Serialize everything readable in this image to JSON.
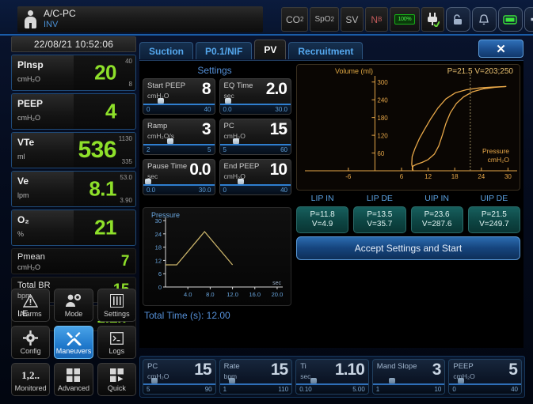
{
  "header": {
    "patient_mode": "A/C-PC",
    "patient_sub": "INV",
    "person_icon": "person-icon",
    "status_icons": [
      {
        "name": "co2-indicator",
        "label": "CO",
        "sub": "2"
      },
      {
        "name": "spo2-indicator",
        "label": "SpO",
        "sub": "2"
      },
      {
        "name": "sv-indicator",
        "label": "SV",
        "sub": ""
      },
      {
        "name": "nb-indicator",
        "label": "N",
        "sub": "B"
      }
    ],
    "battery_label": "100%",
    "plug_icon": "power-plug-icon",
    "lock_icon": "lock-icon",
    "bell_icon": "alarm-bell-icon",
    "screen_icon": "screen-icon",
    "plus_icon": "plus-icon"
  },
  "sidebar": {
    "clock": "22/08/21 10:52:06",
    "measurements": [
      {
        "label": "PInsp",
        "unit": "cmH₂O",
        "value": "20",
        "high": "40",
        "low": "8",
        "big": false
      },
      {
        "label": "PEEP",
        "unit": "cmH₂O",
        "value": "4",
        "high": "",
        "low": "",
        "big": false
      },
      {
        "label": "VTe",
        "unit": "ml",
        "value": "536",
        "high": "1130",
        "low": "335",
        "big": true
      },
      {
        "label": "Ve",
        "unit": "lpm",
        "value": "8.1",
        "high": "53.0",
        "low": "3.90",
        "big": false
      },
      {
        "label": "O₂",
        "unit": "%",
        "value": "21",
        "high": "",
        "low": "",
        "big": false
      }
    ],
    "secondary": [
      {
        "label": "Pmean",
        "unit": "cmH₂O",
        "value": "7"
      },
      {
        "label": "Total BR",
        "unit": "bpm",
        "value": "15"
      },
      {
        "label": "I:E",
        "unit": "",
        "value": "1:2.7"
      }
    ],
    "buttons": [
      {
        "label": "Alarms",
        "icon": "warning-triangle-icon",
        "active": false
      },
      {
        "label": "Mode",
        "icon": "user-gear-icon",
        "active": false
      },
      {
        "label": "Settings",
        "icon": "sliders-icon",
        "active": false
      },
      {
        "label": "Config",
        "icon": "gear-icon",
        "active": false
      },
      {
        "label": "Maneuvers",
        "icon": "tools-icon",
        "active": true
      },
      {
        "label": "Logs",
        "icon": "terminal-icon",
        "active": false
      },
      {
        "label": "Monitored",
        "icon": "numbers-icon",
        "active": false
      },
      {
        "label": "Advanced",
        "icon": "grid-icon",
        "active": false
      },
      {
        "label": "Quick",
        "icon": "grid-play-icon",
        "active": false
      }
    ]
  },
  "main": {
    "tabs": [
      {
        "label": "Suction",
        "active": false
      },
      {
        "label": "P0.1/NIF",
        "active": false
      },
      {
        "label": "PV",
        "active": true
      },
      {
        "label": "Recruitment",
        "active": false
      }
    ],
    "close_label": "✕",
    "settings_title": "Settings",
    "settings": [
      {
        "label": "Start PEEP",
        "unit": "cmH₂O",
        "value": "8",
        "min": "0",
        "max": "40",
        "pct": 20
      },
      {
        "label": "EQ Time",
        "unit": "sec",
        "value": "2.0",
        "min": "0.0",
        "max": "30.0",
        "pct": 7
      },
      {
        "label": "Ramp",
        "unit": "cmH₂O/s",
        "value": "3",
        "min": "2",
        "max": "5",
        "pct": 33
      },
      {
        "label": "PC",
        "unit": "cmH₂O",
        "value": "15",
        "min": "5",
        "max": "60",
        "pct": 18
      },
      {
        "label": "Pause Time",
        "unit": "sec",
        "value": "0.0",
        "min": "0.0",
        "max": "30.0",
        "pct": 2
      },
      {
        "label": "End PEEP",
        "unit": "cmH₂O",
        "value": "10",
        "min": "0",
        "max": "40",
        "pct": 25
      }
    ],
    "total_time": "Total Time (s): 12.00",
    "inflection_headers": [
      "LIP IN",
      "LIP DE",
      "UIP IN",
      "UIP DE"
    ],
    "inflection_values": [
      {
        "p": "P=11.8",
        "v": "V=4.9"
      },
      {
        "p": "P=13.5",
        "v": "V=35.7"
      },
      {
        "p": "P=23.6",
        "v": "V=287.6"
      },
      {
        "p": "P=21.5",
        "v": "V=249.7"
      }
    ],
    "accept_label": "Accept Settings and Start"
  },
  "bottom_params": [
    {
      "label": "PC",
      "unit": "cmH₂O",
      "value": "15",
      "min": "5",
      "max": "90",
      "pct": 11
    },
    {
      "label": "Rate",
      "unit": "bpm",
      "value": "15",
      "min": "1",
      "max": "110",
      "pct": 13
    },
    {
      "label": "Ti",
      "unit": "sec",
      "value": "1.10",
      "min": "0.10",
      "max": "5.00",
      "pct": 20
    },
    {
      "label": "Mand Slope",
      "unit": "",
      "value": "3",
      "min": "1",
      "max": "10",
      "pct": 22
    },
    {
      "label": "PEEP",
      "unit": "cmH₂O",
      "value": "5",
      "min": "0",
      "max": "40",
      "pct": 12
    }
  ],
  "chart_data": [
    {
      "type": "line",
      "name": "pv-loop",
      "title": "P=21.5 V=203;250",
      "ylabel": "Volume (ml)",
      "xlabel": "Pressure",
      "xunit": "cmH₂O",
      "xticks": [
        -6,
        6,
        12,
        18,
        24,
        30
      ],
      "yticks": [
        60,
        120,
        180,
        240,
        300
      ],
      "xlim": [
        -9,
        31
      ],
      "ylim": [
        0,
        310
      ],
      "cursor_pressure": 21.5,
      "grid": false,
      "color": "#e8a849",
      "series": [
        {
          "name": "inflation",
          "points": [
            [
              8.6,
              0
            ],
            [
              8.3,
              22
            ],
            [
              8.4,
              48
            ],
            [
              9.0,
              74
            ],
            [
              10.0,
              108
            ],
            [
              11.2,
              140
            ],
            [
              12.6,
              176
            ],
            [
              14.2,
              212
            ],
            [
              16.0,
              243
            ],
            [
              18.2,
              264
            ],
            [
              20.6,
              274
            ],
            [
              23.6,
              280
            ],
            [
              26.5,
              283
            ],
            [
              29.6,
              285
            ]
          ]
        },
        {
          "name": "deflation",
          "points": [
            [
              29.6,
              285
            ],
            [
              27.0,
              282
            ],
            [
              24.5,
              277
            ],
            [
              22.0,
              267
            ],
            [
              20.0,
              250
            ],
            [
              18.4,
              228
            ],
            [
              17.0,
              196
            ],
            [
              16.0,
              160
            ],
            [
              15.2,
              120
            ],
            [
              14.4,
              84
            ],
            [
              13.4,
              56
            ],
            [
              12.0,
              38
            ],
            [
              10.6,
              28
            ],
            [
              9.4,
              22
            ],
            [
              8.6,
              16
            ],
            [
              8.4,
              6
            ],
            [
              8.6,
              0
            ]
          ]
        }
      ]
    },
    {
      "type": "line",
      "name": "pressure-waveform",
      "title": "Pressure",
      "xlabel": "sec",
      "ylabel": "",
      "xticks": [
        4.0,
        8.0,
        12.0,
        16.0,
        20.0
      ],
      "yticks": [
        0,
        6,
        12,
        18,
        24,
        30
      ],
      "xlim": [
        0,
        21
      ],
      "ylim": [
        0,
        30
      ],
      "grid": false,
      "color": "#c9b36a",
      "points": [
        [
          0,
          10
        ],
        [
          2.0,
          10
        ],
        [
          7.0,
          25
        ],
        [
          12.0,
          10
        ]
      ]
    }
  ]
}
